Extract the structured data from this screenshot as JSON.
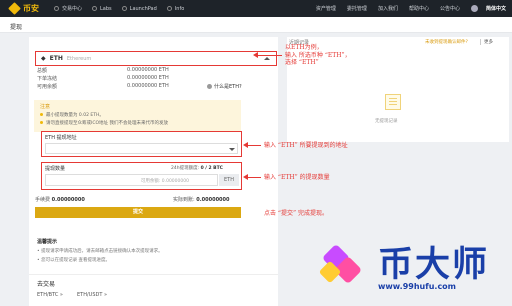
{
  "header": {
    "logo_text": "币安",
    "nav": [
      "交易中心",
      "Labs",
      "LaunchPad",
      "Info"
    ],
    "right_nav": [
      "资产管理",
      "委托管理",
      "加入我们",
      "帮助中心",
      "公告中心"
    ],
    "language": "简体中文"
  },
  "page_title": "提现",
  "coin": {
    "symbol": "ETH",
    "name": "Ethereum"
  },
  "balances": [
    {
      "label": "总额",
      "value": "0.00000000 ETH"
    },
    {
      "label": "下单冻结",
      "value": "0.00000000 ETH"
    },
    {
      "label": "可用余额",
      "value": "0.00000000 ETH"
    }
  ],
  "help_link": "什么是ETH?",
  "notice": {
    "title": "注意",
    "lines": [
      "最小提现数量为 0.02 ETH。",
      "请勿直接提现至众筹或ICO地址 我们不会处理未来代币的发放"
    ]
  },
  "address_label": "ETH 提现地址",
  "amount": {
    "label": "提现数量",
    "limit_prefix": "24h提现额度:",
    "limit_value": "0 / 2 BTC",
    "available": "可用余额: 0.00000000",
    "unit": "ETH"
  },
  "fee": {
    "label": "手续费",
    "value": "0.00000000"
  },
  "receive": {
    "label": "实际到账:",
    "value": "0.00000000"
  },
  "submit_label": "提交",
  "tips": {
    "title": "温馨提示",
    "lines": [
      "提现请求申请成功后，请去邮箱点击链接确认本次提现请求。",
      "您可以在提现记录 查看提现进度。"
    ]
  },
  "go_trade": {
    "title": "去交易",
    "pairs": [
      "ETH/BTC »",
      "ETH/USDT »"
    ]
  },
  "history": {
    "title": "近期记录",
    "check_link": "未收到提现确认邮件?",
    "more": "更多",
    "empty": "无提现记录"
  },
  "annotations": [
    "以ETH为例，\n输入 所选币种 “ETH”，\n选择 “ETH”",
    "输入 “ETH” 所要提现到的地址",
    "输入 “ETH” 的提现数量",
    "点击 “提交” 完成提现。"
  ],
  "watermark": {
    "big": "币大师",
    "url": "www.99hufu.com"
  },
  "colors": {
    "accent": "#f0b90b",
    "highlight": "#e53935",
    "topbar": "#1e2329",
    "submit": "#dba812"
  }
}
